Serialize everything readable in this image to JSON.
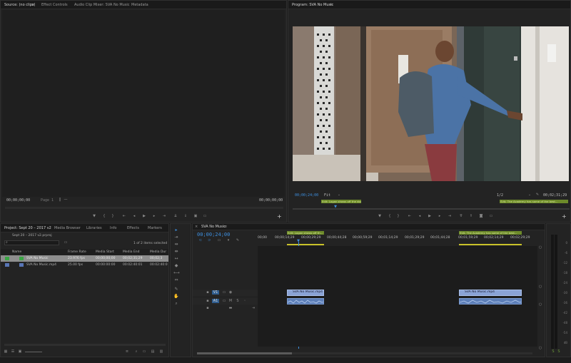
{
  "source_panel": {
    "tabs": [
      "Source: (no clips)",
      "Effect Controls",
      "Audio Clip Mixer: SVA No Music",
      "Metadata"
    ],
    "tc_left": "00;00;00;00",
    "page": "Page 1",
    "tc_right": "00;00;00;00"
  },
  "program_panel": {
    "tab": "Program: SVA No Music",
    "tc_left": "00;00;24;00",
    "fit": "Fit",
    "quality": "1/2",
    "tc_right": "00;02;31;29",
    "markers": [
      "Edit: Logan shows off the door...",
      "SVA: The Academy has some of the best..."
    ]
  },
  "project_panel": {
    "tabs": [
      "Project: Sept 20 – 2017 v2",
      "Media Browser",
      "Libraries",
      "Info",
      "Effects",
      "Markers"
    ],
    "file": "Sept 20 – 2017 v2.prproj",
    "selection": "1 of 2 items selected",
    "columns": [
      "Name",
      "Frame Rate",
      "Media Start",
      "Media End",
      "Media Dur"
    ],
    "rows": [
      {
        "name": "SVA No Music",
        "rate": "23.976 fps",
        "start": "00;00;00;00",
        "end": "00;02;31;29",
        "dur": "00;02;3"
      },
      {
        "name": "SVA No Music.mp4",
        "rate": "25.00 fps",
        "start": "00:00:00:00",
        "end": "00:02:40:01",
        "dur": "00:02:40:0"
      }
    ],
    "colors": {
      "sequence": "#3aa544",
      "clip": "#5875b6"
    }
  },
  "timeline": {
    "tab": "SVA No Music",
    "timecode": "00;00;24;00",
    "ruler": [
      "00;00",
      "00;00;14;29",
      "00;00;29;29",
      "00;00;44;28",
      "00;00;59;29",
      "00;01;14;29",
      "00;01;29;29",
      "00;01;44;28",
      "00;01;59;29",
      "00;02;14;29",
      "00;02;29;29"
    ],
    "markers": [
      "Edit: Logan shows off th...",
      "SVA: The Academy has some of the best..."
    ],
    "tracks": {
      "v1": "V1",
      "a1": "A1"
    },
    "clip_name": "SVA No Music.mp4",
    "clip_b_name": "SVA No Music.mp4",
    "accent": "#3e8fdf"
  },
  "meter": {
    "labels": [
      "0",
      "-6",
      "-12",
      "-18",
      "-24",
      "-30",
      "-36",
      "-42",
      "-48",
      "-54",
      "dB"
    ],
    "solo": "S",
    "solo2": "S"
  },
  "icons": {
    "search": "search-icon",
    "wrench": "wrench-icon",
    "play": "play-icon"
  }
}
